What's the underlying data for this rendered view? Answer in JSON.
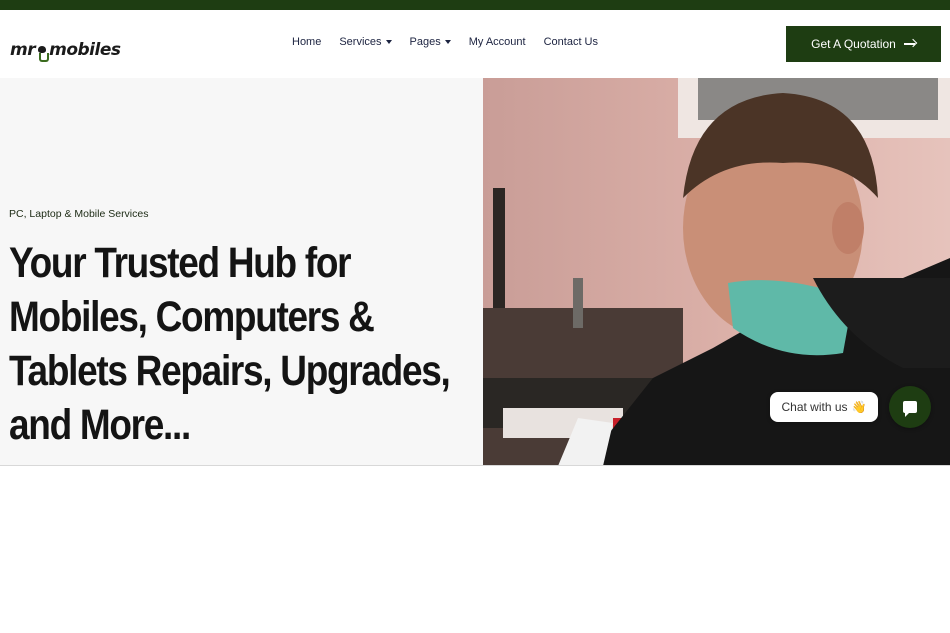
{
  "brand": {
    "logo_text_left": "mr",
    "logo_text_right": "mobiles"
  },
  "nav": {
    "items": [
      {
        "label": "Home",
        "dropdown": false
      },
      {
        "label": "Services",
        "dropdown": true
      },
      {
        "label": "Pages",
        "dropdown": true
      },
      {
        "label": "My Account",
        "dropdown": false
      },
      {
        "label": "Contact Us",
        "dropdown": false
      }
    ]
  },
  "cta": {
    "label": "Get A Quotation"
  },
  "hero": {
    "kicker": "PC, Laptop & Mobile Services",
    "title_lines": [
      "Your Trusted Hub for",
      "Mobiles, Computers &",
      "Tablets Repairs, Upgrades,",
      "and More..."
    ]
  },
  "chat": {
    "label": "Chat with us",
    "emoji": "👋"
  },
  "colors": {
    "brand_green": "#1e3d12",
    "hero_bg": "#f7f7f7",
    "text_dark": "#141414"
  }
}
